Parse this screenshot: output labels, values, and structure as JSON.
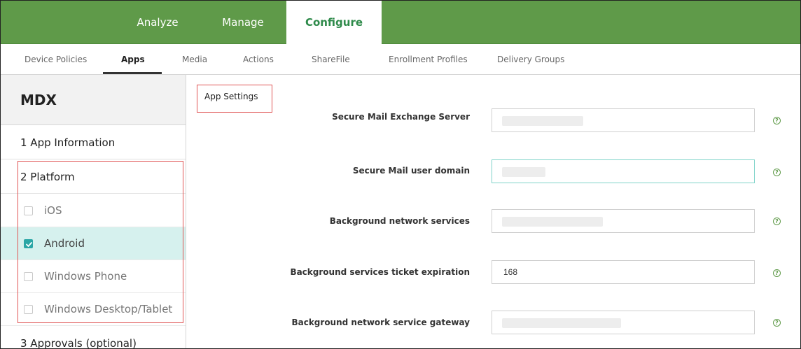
{
  "topnav": {
    "tabs": [
      {
        "label": "Analyze",
        "active": false
      },
      {
        "label": "Manage",
        "active": false
      },
      {
        "label": "Configure",
        "active": true
      }
    ]
  },
  "subnav": {
    "items": [
      {
        "label": "Device Policies",
        "active": false
      },
      {
        "label": "Apps",
        "active": true
      },
      {
        "label": "Media",
        "active": false
      },
      {
        "label": "Actions",
        "active": false
      },
      {
        "label": "ShareFile",
        "active": false
      },
      {
        "label": "Enrollment Profiles",
        "active": false
      },
      {
        "label": "Delivery Groups",
        "active": false
      }
    ]
  },
  "sidebar": {
    "title": "MDX",
    "steps": [
      {
        "label": "1 App Information"
      },
      {
        "label": "2 Platform"
      },
      {
        "label": "3 Approvals (optional)"
      }
    ],
    "platforms": [
      {
        "label": "iOS",
        "checked": false
      },
      {
        "label": "Android",
        "checked": true
      },
      {
        "label": "Windows Phone",
        "checked": false
      },
      {
        "label": "Windows Desktop/Tablet",
        "checked": false
      }
    ]
  },
  "main": {
    "section_tab": "App Settings",
    "fields": [
      {
        "label": "Secure Mail Exchange Server",
        "value": ""
      },
      {
        "label": "Secure Mail user domain",
        "value": ""
      },
      {
        "label": "Background network services",
        "value": ""
      },
      {
        "label": "Background services ticket expiration",
        "value": "168"
      },
      {
        "label": "Background network service gateway",
        "value": ""
      }
    ],
    "help_glyph": "?"
  },
  "colors": {
    "nav_green": "#5f9a49",
    "active_tab_text": "#2e8a4a",
    "checked_row": "#d6f1ee",
    "checkbox_teal": "#2ba6a6",
    "highlight_red": "#e05555",
    "focus_border": "#7fd3c9"
  },
  "icons": {
    "checkbox_checked": "checkmark-icon",
    "help": "question-circle-icon"
  }
}
